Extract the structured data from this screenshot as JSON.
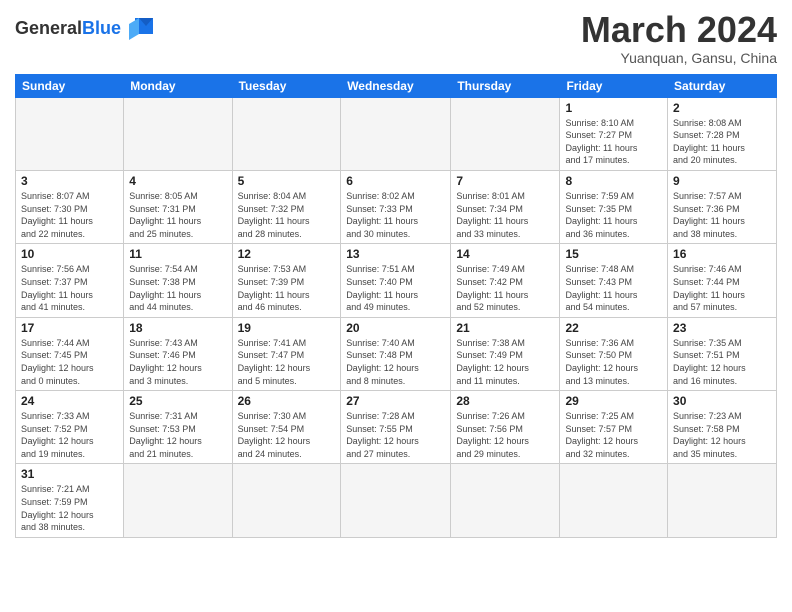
{
  "header": {
    "logo_general": "General",
    "logo_blue": "Blue",
    "month_title": "March 2024",
    "subtitle": "Yuanquan, Gansu, China"
  },
  "weekdays": [
    "Sunday",
    "Monday",
    "Tuesday",
    "Wednesday",
    "Thursday",
    "Friday",
    "Saturday"
  ],
  "weeks": [
    [
      {
        "day": "",
        "info": ""
      },
      {
        "day": "",
        "info": ""
      },
      {
        "day": "",
        "info": ""
      },
      {
        "day": "",
        "info": ""
      },
      {
        "day": "",
        "info": ""
      },
      {
        "day": "1",
        "info": "Sunrise: 8:10 AM\nSunset: 7:27 PM\nDaylight: 11 hours\nand 17 minutes."
      },
      {
        "day": "2",
        "info": "Sunrise: 8:08 AM\nSunset: 7:28 PM\nDaylight: 11 hours\nand 20 minutes."
      }
    ],
    [
      {
        "day": "3",
        "info": "Sunrise: 8:07 AM\nSunset: 7:30 PM\nDaylight: 11 hours\nand 22 minutes."
      },
      {
        "day": "4",
        "info": "Sunrise: 8:05 AM\nSunset: 7:31 PM\nDaylight: 11 hours\nand 25 minutes."
      },
      {
        "day": "5",
        "info": "Sunrise: 8:04 AM\nSunset: 7:32 PM\nDaylight: 11 hours\nand 28 minutes."
      },
      {
        "day": "6",
        "info": "Sunrise: 8:02 AM\nSunset: 7:33 PM\nDaylight: 11 hours\nand 30 minutes."
      },
      {
        "day": "7",
        "info": "Sunrise: 8:01 AM\nSunset: 7:34 PM\nDaylight: 11 hours\nand 33 minutes."
      },
      {
        "day": "8",
        "info": "Sunrise: 7:59 AM\nSunset: 7:35 PM\nDaylight: 11 hours\nand 36 minutes."
      },
      {
        "day": "9",
        "info": "Sunrise: 7:57 AM\nSunset: 7:36 PM\nDaylight: 11 hours\nand 38 minutes."
      }
    ],
    [
      {
        "day": "10",
        "info": "Sunrise: 7:56 AM\nSunset: 7:37 PM\nDaylight: 11 hours\nand 41 minutes."
      },
      {
        "day": "11",
        "info": "Sunrise: 7:54 AM\nSunset: 7:38 PM\nDaylight: 11 hours\nand 44 minutes."
      },
      {
        "day": "12",
        "info": "Sunrise: 7:53 AM\nSunset: 7:39 PM\nDaylight: 11 hours\nand 46 minutes."
      },
      {
        "day": "13",
        "info": "Sunrise: 7:51 AM\nSunset: 7:40 PM\nDaylight: 11 hours\nand 49 minutes."
      },
      {
        "day": "14",
        "info": "Sunrise: 7:49 AM\nSunset: 7:42 PM\nDaylight: 11 hours\nand 52 minutes."
      },
      {
        "day": "15",
        "info": "Sunrise: 7:48 AM\nSunset: 7:43 PM\nDaylight: 11 hours\nand 54 minutes."
      },
      {
        "day": "16",
        "info": "Sunrise: 7:46 AM\nSunset: 7:44 PM\nDaylight: 11 hours\nand 57 minutes."
      }
    ],
    [
      {
        "day": "17",
        "info": "Sunrise: 7:44 AM\nSunset: 7:45 PM\nDaylight: 12 hours\nand 0 minutes."
      },
      {
        "day": "18",
        "info": "Sunrise: 7:43 AM\nSunset: 7:46 PM\nDaylight: 12 hours\nand 3 minutes."
      },
      {
        "day": "19",
        "info": "Sunrise: 7:41 AM\nSunset: 7:47 PM\nDaylight: 12 hours\nand 5 minutes."
      },
      {
        "day": "20",
        "info": "Sunrise: 7:40 AM\nSunset: 7:48 PM\nDaylight: 12 hours\nand 8 minutes."
      },
      {
        "day": "21",
        "info": "Sunrise: 7:38 AM\nSunset: 7:49 PM\nDaylight: 12 hours\nand 11 minutes."
      },
      {
        "day": "22",
        "info": "Sunrise: 7:36 AM\nSunset: 7:50 PM\nDaylight: 12 hours\nand 13 minutes."
      },
      {
        "day": "23",
        "info": "Sunrise: 7:35 AM\nSunset: 7:51 PM\nDaylight: 12 hours\nand 16 minutes."
      }
    ],
    [
      {
        "day": "24",
        "info": "Sunrise: 7:33 AM\nSunset: 7:52 PM\nDaylight: 12 hours\nand 19 minutes."
      },
      {
        "day": "25",
        "info": "Sunrise: 7:31 AM\nSunset: 7:53 PM\nDaylight: 12 hours\nand 21 minutes."
      },
      {
        "day": "26",
        "info": "Sunrise: 7:30 AM\nSunset: 7:54 PM\nDaylight: 12 hours\nand 24 minutes."
      },
      {
        "day": "27",
        "info": "Sunrise: 7:28 AM\nSunset: 7:55 PM\nDaylight: 12 hours\nand 27 minutes."
      },
      {
        "day": "28",
        "info": "Sunrise: 7:26 AM\nSunset: 7:56 PM\nDaylight: 12 hours\nand 29 minutes."
      },
      {
        "day": "29",
        "info": "Sunrise: 7:25 AM\nSunset: 7:57 PM\nDaylight: 12 hours\nand 32 minutes."
      },
      {
        "day": "30",
        "info": "Sunrise: 7:23 AM\nSunset: 7:58 PM\nDaylight: 12 hours\nand 35 minutes."
      }
    ],
    [
      {
        "day": "31",
        "info": "Sunrise: 7:21 AM\nSunset: 7:59 PM\nDaylight: 12 hours\nand 38 minutes."
      },
      {
        "day": "",
        "info": ""
      },
      {
        "day": "",
        "info": ""
      },
      {
        "day": "",
        "info": ""
      },
      {
        "day": "",
        "info": ""
      },
      {
        "day": "",
        "info": ""
      },
      {
        "day": "",
        "info": ""
      }
    ]
  ]
}
